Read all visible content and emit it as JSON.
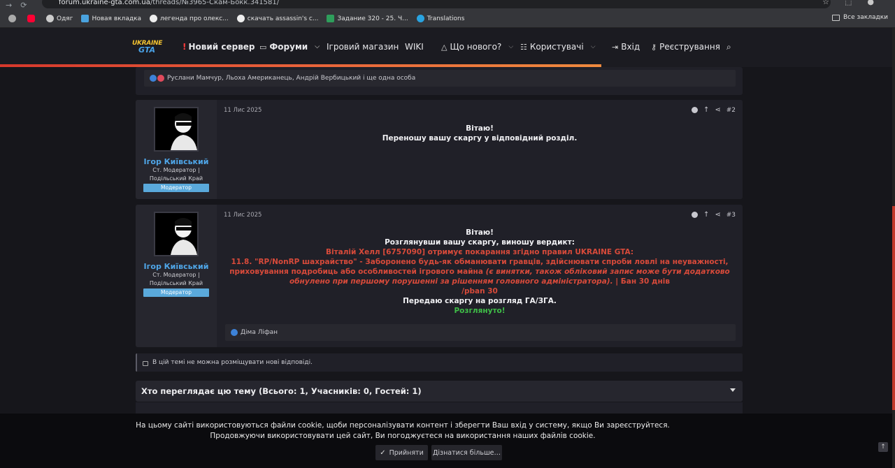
{
  "browser": {
    "url_host": "forum.ukraine-gta.com.ua",
    "url_path": "/threads/№3965-Скам-Бокк.341581/",
    "bookmarks": [
      {
        "label": "",
        "color": "#aaaaaa"
      },
      {
        "label": "",
        "color": "#ff0033"
      },
      {
        "label": "Одяг",
        "color": "#cccccc"
      },
      {
        "label": "Новая вкладка",
        "color": "#4aa3df"
      },
      {
        "label": "легенда про олекс...",
        "color": "#eeeeee"
      },
      {
        "label": "скачать assassin's c...",
        "color": "#eeeeee"
      },
      {
        "label": "Задание 320 - 25. Ч...",
        "color": "#2e9e5b"
      },
      {
        "label": "Translations",
        "color": "#29a3e0"
      }
    ],
    "all_bookmarks": "Все закладки"
  },
  "header": {
    "logo_line1": "UKRAINE",
    "logo_line2": "GTA",
    "new_server_mark": "!",
    "new_server": "Новий сервер",
    "forums": "Форуми",
    "shop": "Ігровий магазин",
    "wiki": "WIKI",
    "whats_new": "Що нового?",
    "users": "Користувачі",
    "login": "Вхід",
    "register": "Реєстрування"
  },
  "top_reactions": "Руслани Мамчур, Льоха Американець, Андрій Вербицький і ще одна особа",
  "posts": [
    {
      "date": "11 Лис 2025",
      "number": "#2",
      "username": "Ігор Київський",
      "user_title_1": "Ст. Модератор |",
      "user_title_2": "Подільський Край",
      "badge": "Модератор",
      "lines": [
        "Вітаю!",
        "Переношу вашу скаргу у відповідний розділ."
      ]
    },
    {
      "date": "11 Лис 2025",
      "number": "#3",
      "username": "Ігор Київський",
      "user_title_1": "Ст. Модератор |",
      "user_title_2": "Подільський Край",
      "badge": "Модератор",
      "line1": "Вітаю!",
      "line2": "Розглянувши вашу скаргу, виношу вердикт:",
      "line3": "Віталій Хелл [6757090] отримує покарання згідно правил UKRAINE GTA:",
      "rule_text": "11.8. \"RP/NonRP шахрайство\" - Заборонено будь-як обманювати гравців, здійснювати спроби ловлі на неуважності, приховування подробиць або особливостей ігрового майна",
      "rule_italic": "(є винятки, також обліковий запис може бути додатково обнулено при першому порушенні за рішенням головного адміністратора).",
      "rule_tail": "| Бан 30 днів",
      "line_cmd": "/pban 30",
      "line_transfer": "Передаю скаргу на розгляд ГА/ЗГА.",
      "line_status": "Розглянуто!",
      "reactions": "Діма Ліфан"
    }
  ],
  "locked_notice": "В цій темі не можна розміщувати нові відповіді.",
  "viewers_title": "Хто переглядає цю тему (Всього: 1, Учасників: 0, Гостей: 1)",
  "cookie": {
    "line1": "На цьому сайті використовуються файли cookie, щоби персоналізувати контент і зберегти Ваш вхід у систему, якщо Ви зареєструйтеся.",
    "line2": "Продовжуючи використовувати цей сайт, Ви погоджуєтеся на використання наших файлів cookie.",
    "accept": "Прийняти",
    "learn_more": "Дізнатися більше…"
  },
  "colors": {
    "accent_blue": "#4fa6e8",
    "verdict_red": "#d84a3a",
    "status_green": "#3fbf48",
    "progress_orange": "#e8623a"
  }
}
